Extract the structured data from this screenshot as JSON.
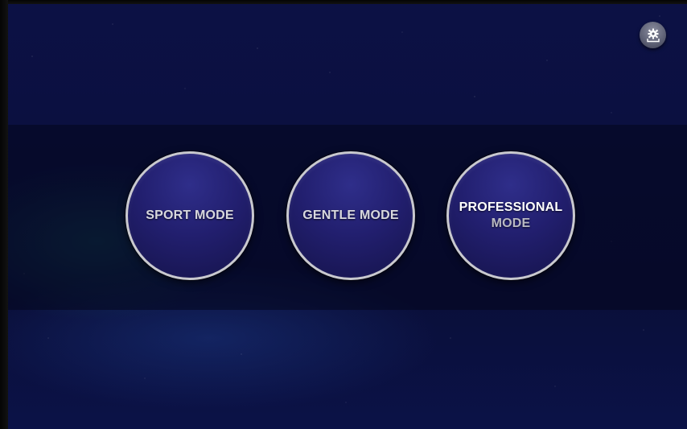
{
  "modes": {
    "sport": {
      "label": "SPORT MODE"
    },
    "gentle": {
      "label": "GENTLE MODE"
    },
    "professional": {
      "line1": "PROFESSIONAL",
      "line2": "MODE"
    }
  },
  "toolbar": {
    "settings_icon": "gear-icon"
  },
  "colors": {
    "background": "#0b1040",
    "button_fill": "#221f6f",
    "button_border": "#c9c9cf",
    "label_text": "#d8d8de"
  }
}
